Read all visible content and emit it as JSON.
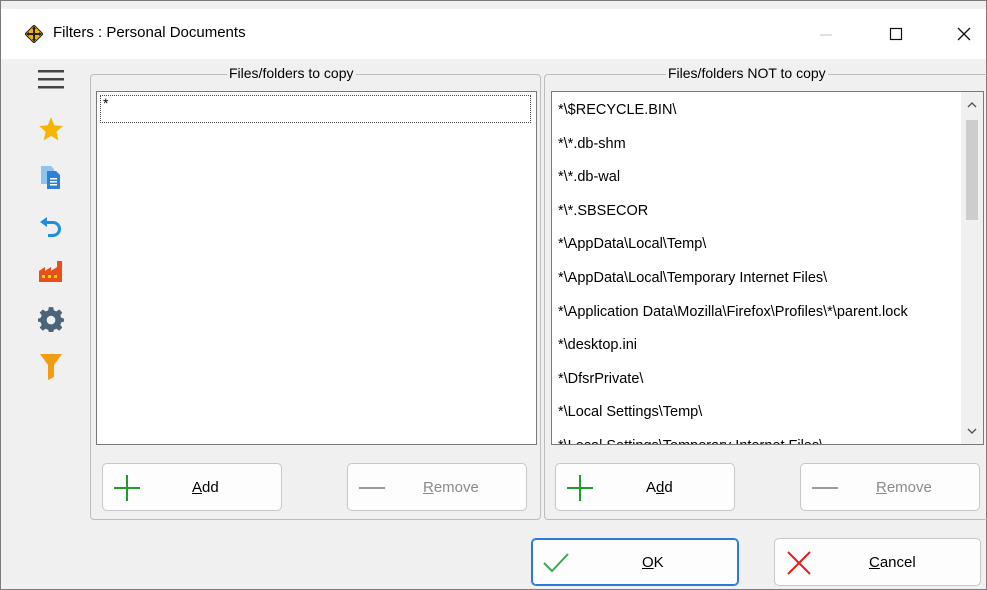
{
  "window": {
    "title": "Filters : Personal Documents"
  },
  "toolbar": {
    "icons": [
      "menu-icon",
      "star-icon",
      "documents-icon",
      "undo-icon",
      "factory-icon",
      "gear-icon",
      "filter-icon"
    ]
  },
  "include_panel": {
    "title": "Files/folders to copy",
    "items": [
      "*"
    ],
    "add_label_pre": "",
    "add_label_key": "A",
    "add_label_post": "dd",
    "remove_label_key": "R",
    "remove_label_post": "emove"
  },
  "exclude_panel": {
    "title": "Files/folders NOT to copy",
    "items": [
      "*\\$RECYCLE.BIN\\",
      "*\\*.db-shm",
      "*\\*.db-wal",
      "*\\*.SBSECOR",
      "*\\AppData\\Local\\Temp\\",
      "*\\AppData\\Local\\Temporary Internet Files\\",
      "*\\Application Data\\Mozilla\\Firefox\\Profiles\\*\\parent.lock",
      "*\\desktop.ini",
      "*\\DfsrPrivate\\",
      "*\\Local Settings\\Temp\\",
      "*\\Local Settings\\Temporary Internet Files\\"
    ],
    "add_label_pre": "A",
    "add_label_key": "d",
    "add_label_post": "d",
    "remove_label_pre": "",
    "remove_label_key": "R",
    "remove_label_post": "emove"
  },
  "footer": {
    "ok_key": "O",
    "ok_post": "K",
    "cancel_key": "C",
    "cancel_post": "ancel"
  },
  "colors": {
    "accent_blue": "#2b7ad8",
    "add_green": "#1e9c2c",
    "ok_green": "#34a853",
    "cancel_red": "#e0201b",
    "star": "#f5b400",
    "filter": "#f39c12"
  }
}
